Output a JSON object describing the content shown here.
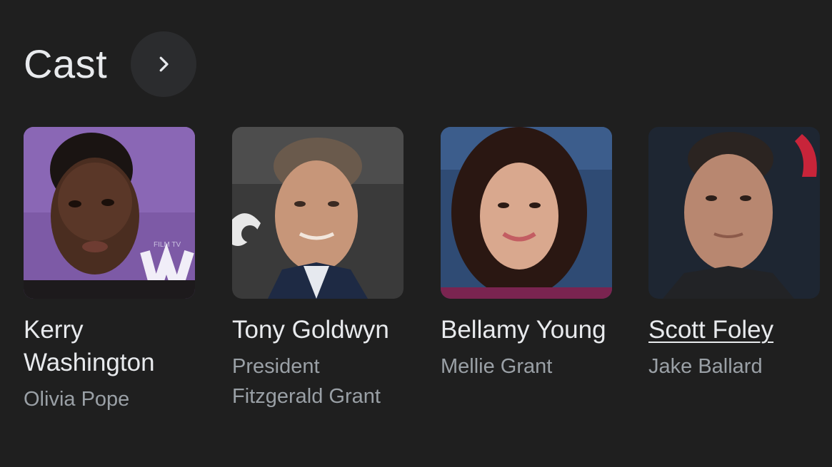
{
  "section": {
    "title": "Cast",
    "more_icon": "chevron-right-icon"
  },
  "colors": {
    "background": "#1f1f1f",
    "button": "#2b2c2e",
    "primary_text": "#e8eaed",
    "secondary_text": "#9aa0a6"
  },
  "cast": [
    {
      "actor": "Kerry Washington",
      "character": "Olivia Pope",
      "photo": "kerry-washington-photo"
    },
    {
      "actor": "Tony Goldwyn",
      "character": "President Fitzgerald Grant",
      "photo": "tony-goldwyn-photo"
    },
    {
      "actor": "Bellamy Young",
      "character": "Mellie Grant",
      "photo": "bellamy-young-photo"
    },
    {
      "actor": "Scott Foley",
      "character": "Jake Ballard",
      "photo": "scott-foley-photo"
    }
  ]
}
